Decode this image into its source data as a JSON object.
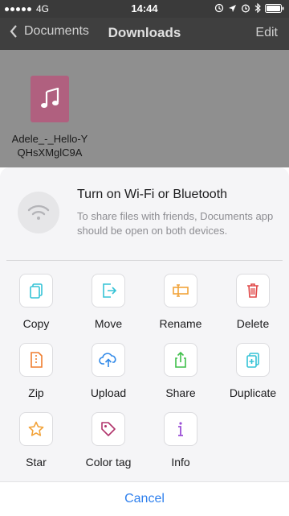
{
  "status_bar": {
    "carrier": "4G",
    "time": "14:44"
  },
  "nav": {
    "back_label": "Documents",
    "title": "Downloads",
    "edit_label": "Edit"
  },
  "file": {
    "name": "Adele_-_Hello-YQHsXMglC9A",
    "thumb_color": "#b0607f"
  },
  "share_info": {
    "title": "Turn on Wi-Fi or Bluetooth",
    "description": "To share files with friends, Documents app should be open on both devices."
  },
  "actions": [
    {
      "label": "Copy",
      "icon": "copy-icon",
      "color": "#35c3d6"
    },
    {
      "label": "Move",
      "icon": "move-icon",
      "color": "#35c3d6"
    },
    {
      "label": "Rename",
      "icon": "rename-icon",
      "color": "#f2a33a"
    },
    {
      "label": "Delete",
      "icon": "delete-icon",
      "color": "#e04848"
    },
    {
      "label": "Zip",
      "icon": "zip-icon",
      "color": "#f07d2e"
    },
    {
      "label": "Upload",
      "icon": "upload-icon",
      "color": "#2f88e8"
    },
    {
      "label": "Share",
      "icon": "share-icon",
      "color": "#3fbf4a"
    },
    {
      "label": "Duplicate",
      "icon": "duplicate-icon",
      "color": "#35c3d6"
    },
    {
      "label": "Star",
      "icon": "star-icon",
      "color": "#f2a33a"
    },
    {
      "label": "Color tag",
      "icon": "tag-icon",
      "color": "#b0336b"
    },
    {
      "label": "Info",
      "icon": "info-icon",
      "color": "#9b4fd6"
    }
  ],
  "cancel_label": "Cancel"
}
